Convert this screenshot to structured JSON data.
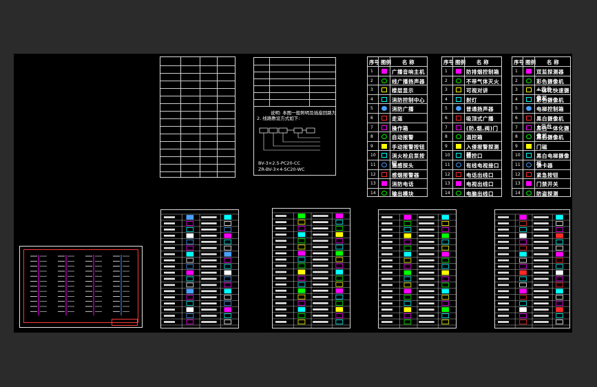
{
  "viewer": {
    "background": "#2b2b2b",
    "drawing_background": "#000000"
  },
  "table_a": {
    "headers": [
      "序号",
      "图例",
      "名 称"
    ],
    "rows": [
      "广播音响主机",
      "线广播扬声器",
      "楼层显示",
      "消防控制中心",
      "消防广播",
      "走道",
      "操作箱",
      "自动报警",
      "手动报警按钮",
      "消火栓启泵按钮",
      "温感探头",
      "感烟报警器",
      "消防电话",
      "输出模块"
    ]
  },
  "table_b": {
    "headers": [
      "序号",
      "图例",
      "名 称"
    ],
    "rows": [
      "防排烟控制箱",
      "不带气体灭火",
      "可视对讲",
      "射灯",
      "普通扬声器",
      "吸顶式广播",
      "(防,烟,阀)门",
      "温控箱",
      "入侵报警探测器",
      "监控口",
      "有线电视接口",
      "电话出线口",
      "电视出线口",
      "电脑出线口"
    ]
  },
  "table_c": {
    "headers": [
      "序号",
      "图例",
      "名 称"
    ],
    "rows": [
      "双监探测器",
      "彩色摄像机+云台",
      "一体化快速摄像机",
      "彩色摄像机",
      "电梯控制箱",
      "黑白摄像机+云台",
      "黑白一体化摄像机",
      "黑白摄像机",
      "门磁",
      "黑白电梯摄像机",
      "读卡器",
      "紧急按钮",
      "门禁开关",
      "防盗探测"
    ]
  },
  "notes": {
    "line1": "说明: 本图一般照明及插座回路为",
    "line2": "2. 线路敷设方式如下:",
    "formula1": "BV-3×2.5-PC20-CC",
    "formula2": "ZR-BV-3×4-SC20-WC"
  }
}
